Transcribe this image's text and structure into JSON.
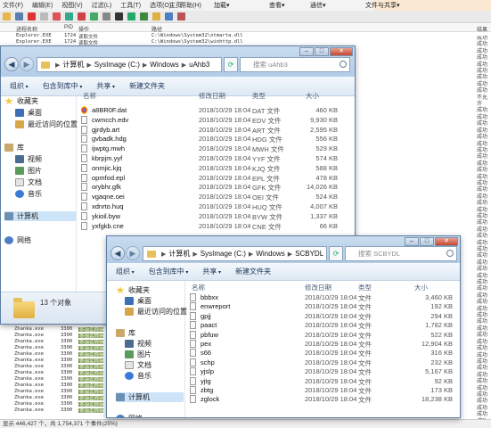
{
  "procmon": {
    "menu": [
      "文件(F)",
      "编辑(E)",
      "视图(V)",
      "过滤(L)",
      "工具(T)",
      "选项(O)",
      "帮助(H)"
    ],
    "top_right_items": [
      "主页",
      "加载▾",
      "查看▾",
      "通信▾",
      "文件与共享▾"
    ],
    "columns": {
      "time": "进程名称",
      "pid": "PID",
      "op": "操作",
      "path": "路径",
      "result": "结果"
    },
    "top_rows": [
      {
        "proc": "Explorer.EXE",
        "pid": "1724",
        "op": "读取文件",
        "path": "C:\\Windows\\System32\\ntmarta.dll"
      },
      {
        "proc": "Explorer.EXE",
        "pid": "1724",
        "op": "读取文件",
        "path": "C:\\Windows\\System32\\winhttp.dll"
      }
    ],
    "bottom_rows": [
      {
        "proc": "Zhanka.exe",
        "pid": "3300",
        "op": "查询名称信"
      },
      {
        "proc": "Zhanka.exe",
        "pid": "3300",
        "op": "查询名称信"
      },
      {
        "proc": "Zhanka.exe",
        "pid": "3300",
        "op": "查询名称信"
      },
      {
        "proc": "Zhanka.exe",
        "pid": "3300",
        "op": "查询名称信"
      },
      {
        "proc": "Zhanka.exe",
        "pid": "3300",
        "op": "查询名称信"
      },
      {
        "proc": "Zhanka.exe",
        "pid": "3300",
        "op": "查询名称信"
      },
      {
        "proc": "Zhanka.exe",
        "pid": "3300",
        "op": "查询名称信"
      },
      {
        "proc": "Zhanka.exe",
        "pid": "3300",
        "op": "查询名称信"
      },
      {
        "proc": "Zhanka.exe",
        "pid": "3300",
        "op": "查询名称信"
      },
      {
        "proc": "Zhanka.exe",
        "pid": "3300",
        "op": "查询名称信"
      },
      {
        "proc": "Zhanka.exe",
        "pid": "3300",
        "op": "查询名称信"
      },
      {
        "proc": "Zhanka.exe",
        "pid": "3300",
        "op": "查询名称信"
      },
      {
        "proc": "Zhanka.exe",
        "pid": "3300",
        "op": "查询名称信"
      },
      {
        "proc": "Zhanka.exe",
        "pid": "3300",
        "op": "查询名称信"
      }
    ],
    "result_column": [
      "成功",
      "成功",
      "成功",
      "成功",
      "成功",
      "成功",
      "成功",
      "成功",
      "成功",
      "不允许",
      "成功",
      "成功",
      "成功",
      "成功",
      "成功",
      "成功",
      "成功",
      "成功",
      "成功",
      "成功",
      "成功",
      "成功",
      "成功",
      "成功",
      "成功",
      "成功",
      "成功",
      "成功",
      "成功",
      "成功",
      "成功",
      "成功",
      "成功",
      "成功",
      "成功",
      "成功",
      "成功",
      "成功",
      "成功",
      "成功",
      "成功",
      "成功",
      "成功",
      "成功",
      "成功",
      "成功",
      "成功",
      "成功",
      "成功",
      "成功",
      "成功",
      "成功",
      "成功",
      "成功",
      "成功",
      "成功",
      "成功",
      "成功"
    ],
    "status": "显示 446,427 个，共 1,754,371 个事件(25%)"
  },
  "win1": {
    "path": [
      "计算机",
      "SysImage (C:)",
      "Windows",
      "uAhb3"
    ],
    "search_placeholder": "搜索 uAhb3",
    "toolbar": [
      "组织",
      "包含到库中",
      "共享",
      "新建文件夹"
    ],
    "columns": {
      "name": "名称",
      "date": "修改日期",
      "type": "类型",
      "size": "大小"
    },
    "nav": {
      "favorites": "收藏夹",
      "desktop": "桌面",
      "recent": "最近访问的位置",
      "libraries": "库",
      "videos": "视频",
      "pictures": "图片",
      "documents": "文档",
      "music": "音乐",
      "computer": "计算机",
      "network": "网络"
    },
    "files": [
      {
        "name": "a8BR0F.dat",
        "date": "2018/10/29 18:04",
        "type": "DAT 文件",
        "size": "460 KB",
        "icon": "chrome-icon"
      },
      {
        "name": "cwmcch.edv",
        "date": "2018/10/29 18:04",
        "type": "EDV 文件",
        "size": "9,930 KB"
      },
      {
        "name": "gjrdyb.art",
        "date": "2018/10/29 18:04",
        "type": "ART 文件",
        "size": "2,595 KB"
      },
      {
        "name": "gvbadk.hdg",
        "date": "2018/10/29 18:04",
        "type": "HDG 文件",
        "size": "556 KB"
      },
      {
        "name": "ijwptg.mwh",
        "date": "2018/10/29 18:04",
        "type": "MWH 文件",
        "size": "529 KB"
      },
      {
        "name": "kbrpjm.yyf",
        "date": "2018/10/29 18:04",
        "type": "YYF 文件",
        "size": "574 KB"
      },
      {
        "name": "onmjic.kjq",
        "date": "2018/10/29 18:04",
        "type": "KJQ 文件",
        "size": "588 KB"
      },
      {
        "name": "opmfod.epl",
        "date": "2018/10/29 18:04",
        "type": "EPL 文件",
        "size": "478 KB"
      },
      {
        "name": "orybhr.gfk",
        "date": "2018/10/29 18:04",
        "type": "GFK 文件",
        "size": "14,026 KB"
      },
      {
        "name": "vgaqne.oei",
        "date": "2018/10/29 18:04",
        "type": "OEI 文件",
        "size": "524 KB"
      },
      {
        "name": "xdnrto.huq",
        "date": "2018/10/29 18:04",
        "type": "HUQ 文件",
        "size": "4,007 KB"
      },
      {
        "name": "ykioil.byw",
        "date": "2018/10/29 18:04",
        "type": "BYW 文件",
        "size": "1,337 KB"
      },
      {
        "name": "yxfgkb.cne",
        "date": "2018/10/29 18:04",
        "type": "CNE 文件",
        "size": "66 KB"
      }
    ],
    "item_count": "13 个对象"
  },
  "win2": {
    "path": [
      "计算机",
      "SysImage (C:)",
      "Windows",
      "SCBYDL"
    ],
    "search_placeholder": "搜索 SCBYDL",
    "toolbar": [
      "组织",
      "包含到库中",
      "共享",
      "新建文件夹"
    ],
    "columns": {
      "name": "名称",
      "date": "修改日期",
      "type": "类型",
      "size": "大小"
    },
    "nav": {
      "favorites": "收藏夹",
      "desktop": "桌面",
      "recent": "最近访问的位置",
      "libraries": "库",
      "videos": "视频",
      "pictures": "图片",
      "documents": "文档",
      "music": "音乐",
      "computer": "计算机",
      "network": "网络"
    },
    "files": [
      {
        "name": "bbbxx",
        "date": "2018/10/29 18:04",
        "type": "文件",
        "size": "3,460 KB"
      },
      {
        "name": "enwreport",
        "date": "2018/10/29 18:04",
        "type": "文件",
        "size": "192 KB"
      },
      {
        "name": "gpjj",
        "date": "2018/10/29 18:04",
        "type": "文件",
        "size": "294 KB"
      },
      {
        "name": "paact",
        "date": "2018/10/29 18:04",
        "type": "文件",
        "size": "1,782 KB"
      },
      {
        "name": "pbfuw",
        "date": "2018/10/29 18:04",
        "type": "文件",
        "size": "522 KB"
      },
      {
        "name": "pex",
        "date": "2018/10/29 18:04",
        "type": "文件",
        "size": "12,904 KB"
      },
      {
        "name": "s66",
        "date": "2018/10/29 18:04",
        "type": "文件",
        "size": "316 KB"
      },
      {
        "name": "schp",
        "date": "2018/10/29 18:04",
        "type": "文件",
        "size": "232 KB"
      },
      {
        "name": "yjslp",
        "date": "2018/10/29 18:04",
        "type": "文件",
        "size": "5,167 KB"
      },
      {
        "name": "yjtg",
        "date": "2018/10/29 18:04",
        "type": "文件",
        "size": "92 KB"
      },
      {
        "name": "zbtg",
        "date": "2018/10/29 18:04",
        "type": "文件",
        "size": "173 KB"
      },
      {
        "name": "zglock",
        "date": "2018/10/29 18:04",
        "type": "文件",
        "size": "18,238 KB"
      }
    ]
  },
  "colors": {
    "accent": "#5d7ea4",
    "folder": "#e8c15b",
    "chart_bar": "#7b9c4d"
  }
}
